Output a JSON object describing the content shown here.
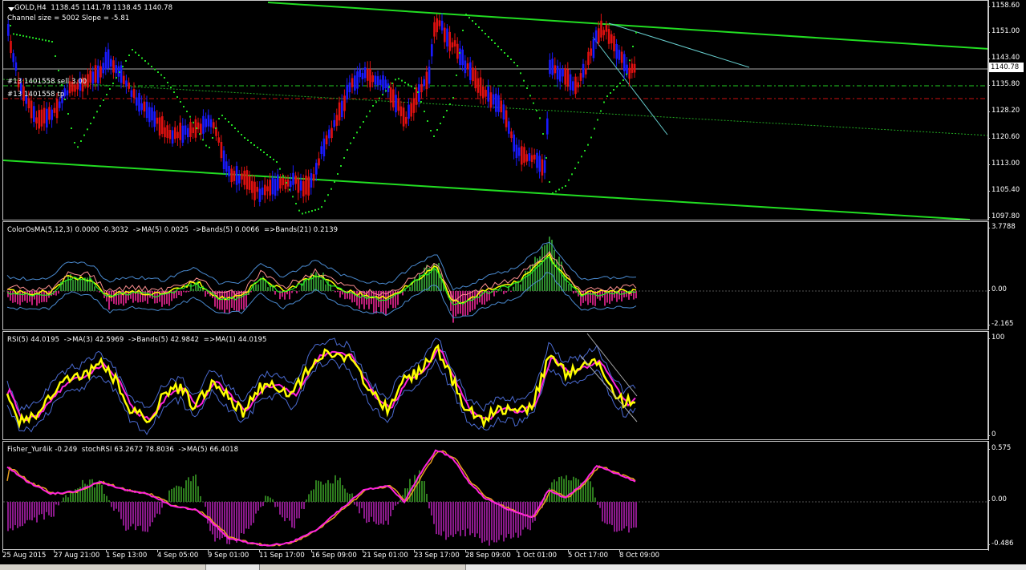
{
  "main": {
    "header": "GOLD,H4  1138.45 1141.78 1138.45 1140.78",
    "channel": "Channel size = 5002 Slope = -5.81",
    "order_sell": "#13 1401558 sell 3.00",
    "order_tp": "#13 1401558 tp",
    "price_ticks": [
      "1158.60",
      "1151.00",
      "1143.40",
      "1135.80",
      "1128.20",
      "1120.60",
      "1113.00",
      "1105.40",
      "1097.80"
    ],
    "current_price": "1140.78",
    "colors": {
      "bull": "#1a1aff",
      "bear": "#e01010",
      "channel": "#22dd22",
      "psar": "#22dd22",
      "trendline": "#66cccc",
      "sell_line": "#22cc22",
      "tp_line": "#cc1111"
    }
  },
  "osma": {
    "label": "ColorOsMA(5,12,3) 0.0000 -0.3032  ->MA(5) 0.0025  ->Bands(5) 0.0066  =>Bands(21) 0.2139",
    "ticks": [
      "3.7788",
      "0.00",
      "-2.165"
    ],
    "colors": {
      "pos": "#2e8b2e",
      "neg": "#c0207a"
    }
  },
  "rsi": {
    "label": "RSI(5) 44.0195  ->MA(3) 42.5969  ->Bands(5) 42.9842  =>MA(1) 44.0195",
    "ticks": [
      "100",
      "0"
    ],
    "colors": {
      "rsi": "#ffff00",
      "ma": "#ff22dd",
      "bands": "#4a6ad0"
    }
  },
  "fisher": {
    "label": "Fisher_Yur4ik -0.249  stochRSI 63.2672 78.8036  ->MA(5) 66.4018",
    "ticks": [
      "0.575",
      "0.00",
      "-0.486"
    ],
    "colors": {
      "pos": "#2e7d1e",
      "neg": "#8b1a8b",
      "stoch": "#ff22dd",
      "ma": "#e8a020"
    }
  },
  "time_labels": [
    "25 Aug 2015",
    "27 Aug 21:00",
    "1 Sep 13:00",
    "4 Sep 05:00",
    "9 Sep 01:00",
    "11 Sep 17:00",
    "16 Sep 09:00",
    "21 Sep 01:00",
    "23 Sep 17:00",
    "28 Sep 09:00",
    "1 Oct 01:00",
    "5 Oct 17:00",
    "8 Oct 09:00"
  ],
  "tab_icons": [
    "chart-tab",
    "chart-tab",
    "chart-tab"
  ]
}
